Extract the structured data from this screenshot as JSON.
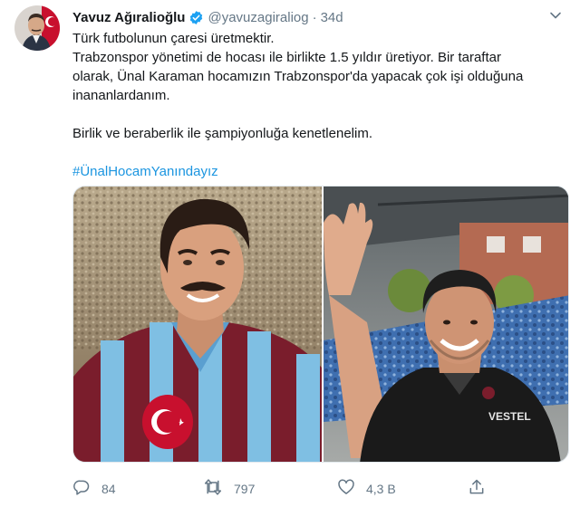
{
  "tweet": {
    "author_name": "Yavuz Ağıralioğlu",
    "handle": "@yavuzagiraliog",
    "separator": "·",
    "timestamp": "34d",
    "text_lines": [
      "Türk futbolunun çaresi üretmektir.",
      "Trabzonspor yönetimi de hocası ile birlikte 1.5 yıldır üretiyor. Bir taraftar",
      "olarak, Ünal Karaman hocamızın Trabzonspor'da yapacak çok işi olduğuna",
      "inananlardanım."
    ],
    "text_line_2": "Birlik ve beraberlik ile şampiyonluğa kenetlenelim.",
    "hashtag": "#ÜnalHocamYanındayız",
    "jersey_text": "VESTEL"
  },
  "actions": {
    "reply_count": "84",
    "retweet_count": "797",
    "like_count": "4,3 B"
  },
  "colors": {
    "link": "#1b95e0",
    "verified": "#1da1f2",
    "muted": "#657786",
    "claret": "#8b1e2e",
    "sky_blue": "#6fb6e0"
  },
  "icons": [
    "chevron-down-icon",
    "verified-badge-icon",
    "reply-icon",
    "retweet-icon",
    "like-icon",
    "share-icon"
  ]
}
